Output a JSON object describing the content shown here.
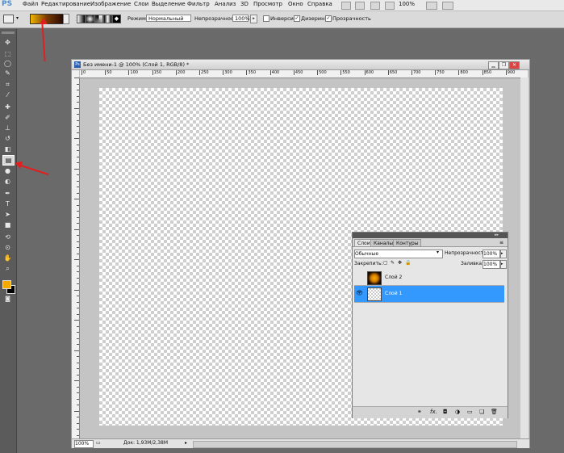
{
  "app": {
    "logo": "PS"
  },
  "menu": {
    "items": [
      "Файл",
      "Редактирование",
      "Изображение",
      "Слои",
      "Выделение",
      "Фильтр",
      "Анализ",
      "3D",
      "Просмотр",
      "Окно",
      "Справка"
    ],
    "zoom": "100%"
  },
  "options": {
    "mode_label": "Режим:",
    "mode_value": "Нормальный",
    "opacity_label": "Непрозрачность:",
    "opacity_value": "100%",
    "invert_label": "Инверсия",
    "dither_label": "Дизеринг",
    "transparency_label": "Прозрачность",
    "gradient_colors": [
      "#f0b400",
      "#7a3a00",
      "#2a0a00"
    ]
  },
  "toolbar": {
    "icons": [
      "move-icon",
      "marquee-icon",
      "lasso-icon",
      "quick-select-icon",
      "crop-icon",
      "eyedropper-icon",
      "healing-icon",
      "brush-icon",
      "stamp-icon",
      "history-brush-icon",
      "eraser-icon",
      "gradient-icon",
      "blur-icon",
      "dodge-icon",
      "pen-icon",
      "type-icon",
      "path-select-icon",
      "shape-icon",
      "3d-rotate-icon",
      "3d-orbit-icon",
      "hand-icon",
      "zoom-icon"
    ],
    "foreground_color": "#f5a800",
    "background_color": "#000000",
    "active_tool": "gradient-icon"
  },
  "document": {
    "title": "Без имени-1 @ 100% (Слой 1, RGB/8) *",
    "ruler_marks": [
      "0",
      "50",
      "100",
      "150",
      "200",
      "250",
      "300",
      "350",
      "400",
      "450",
      "500",
      "550",
      "600",
      "650",
      "700",
      "750",
      "800",
      "850",
      "900"
    ],
    "zoom": "100%",
    "doc_info": "Док: 1,93M/2,38M"
  },
  "layers_panel": {
    "tabs": [
      "Слои",
      "Каналы",
      "Контуры"
    ],
    "blend_mode": "Обычные",
    "opacity_label": "Непрозрачность:",
    "opacity_value": "100%",
    "lock_label": "Закрепить:",
    "fill_label": "Заливка:",
    "fill_value": "100%",
    "layers": [
      {
        "name": "Слой 2",
        "visible": false,
        "selected": false
      },
      {
        "name": "Слой 1",
        "visible": true,
        "selected": true
      }
    ],
    "footer_icons": [
      "link-icon",
      "fx-icon",
      "mask-icon",
      "adjustment-icon",
      "group-icon",
      "new-layer-icon",
      "trash-icon"
    ],
    "selection_color": "#3399ff"
  }
}
